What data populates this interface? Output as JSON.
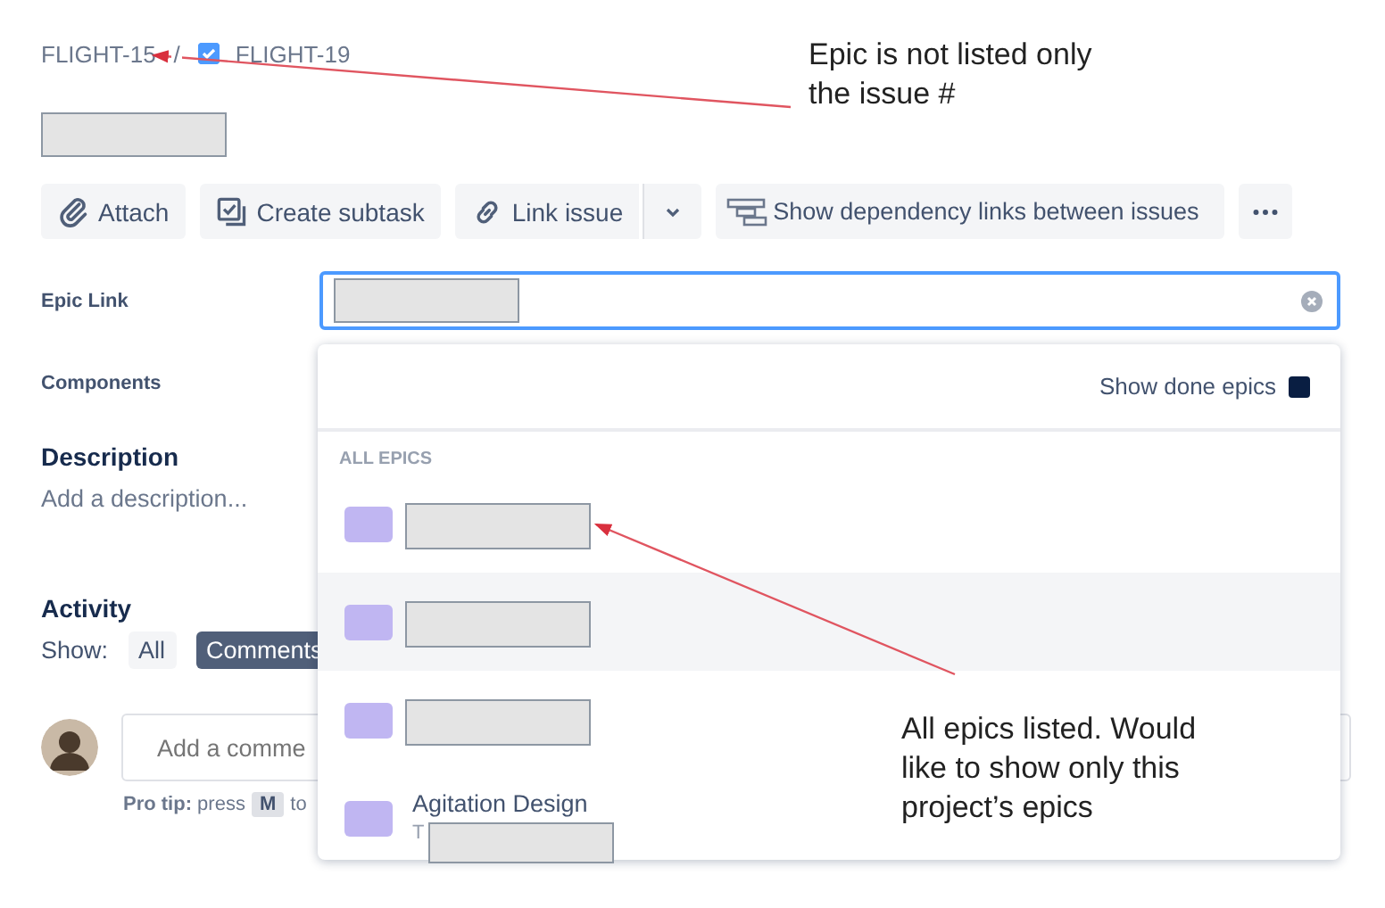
{
  "breadcrumbs": [
    {
      "text": "FLIGHT-15",
      "kind": "parent"
    },
    {
      "text": "FLIGHT-19",
      "kind": "subtask"
    }
  ],
  "separator": "/",
  "title_redacted": true,
  "toolbar": [
    {
      "label": "Attach",
      "kind": "attach"
    },
    {
      "label": "Create subtask",
      "kind": "subtask"
    },
    {
      "label": "Link issue",
      "kind": "link"
    },
    {
      "kind": "caret"
    },
    {
      "label": "Show dependency links between issues",
      "kind": "dependency"
    },
    {
      "kind": "more"
    }
  ],
  "epic_link": {
    "label": "Epic Link",
    "value_redacted": true
  },
  "components": {
    "label": "Components"
  },
  "description": {
    "heading": "Description",
    "placeholder": "Add a description..."
  },
  "activity": {
    "heading": "Activity",
    "show_label": "Show:",
    "filters": [
      {
        "label": "All",
        "selected": false
      },
      {
        "label": "Comments",
        "selected": true
      }
    ],
    "comment_placeholder": "Add a comme",
    "pro_tip": "**Pro tip:** press",
    "key": "M",
    "tip_rest": "to"
  },
  "dropdown": {
    "show_done": {
      "label": "Show done epics",
      "checked": true
    },
    "section": "ALL EPICS",
    "epics": [
      {
        "color": "#c0b6f2",
        "selected": false,
        "redacted": true
      },
      {
        "color": "#c0b6f2",
        "selected": true,
        "redacted": true
      },
      {
        "color": "#c0b6f2",
        "selected": false,
        "redacted": true
      },
      {
        "color": "#c0b6f2",
        "selected": false,
        "redacted": true,
        "title": "Agitation Design",
        "key": "T"
      }
    ]
  },
  "annotations": [
    {
      "text": "Epic is not listed only the issue #"
    },
    {
      "text": "All epics listed. Would like to show only this project’s epics"
    }
  ]
}
